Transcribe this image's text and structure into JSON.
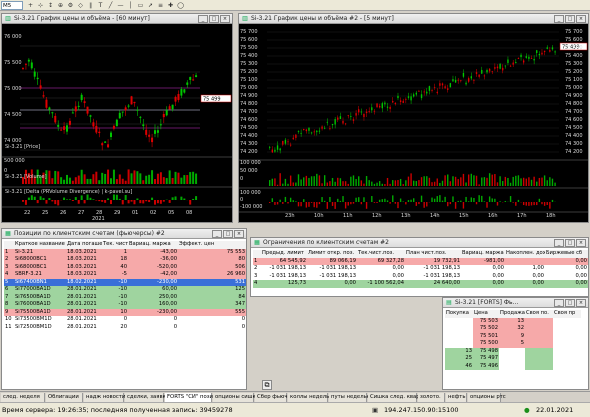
{
  "toolbar": {
    "selector_value": "M5",
    "buttons": [
      {
        "name": "add-button",
        "glyph": "+"
      },
      {
        "name": "crosshair-icon",
        "glyph": "⊹"
      },
      {
        "name": "move-icon",
        "glyph": "↕"
      },
      {
        "name": "zoom-in-icon",
        "glyph": "⊕"
      },
      {
        "name": "settings-icon",
        "glyph": "⚙"
      },
      {
        "name": "shape-icon",
        "glyph": "◇"
      },
      {
        "name": "channel-icon",
        "glyph": "∥"
      },
      {
        "name": "text-tool-icon",
        "glyph": "T"
      },
      {
        "name": "line-tool-icon",
        "glyph": "╱"
      },
      {
        "name": "hline-tool-icon",
        "glyph": "—"
      },
      {
        "name": "vline-tool-icon",
        "glyph": "│"
      },
      {
        "name": "rect-tool-icon",
        "glyph": "▭"
      },
      {
        "name": "arrow-tool-icon",
        "glyph": "➚"
      },
      {
        "name": "fib-tool-icon",
        "glyph": "≡"
      },
      {
        "name": "mark-tool-icon",
        "glyph": "✚"
      },
      {
        "name": "cycle-tool-icon",
        "glyph": "◯"
      }
    ]
  },
  "chart1": {
    "title": "Si-3.21 График цены и объёма - [60 минут]",
    "price_label": "Si-3.21 [Price]",
    "volume_label": "Si-3.21 [Volume]",
    "delta_label": "Si-3.21 [Delta (PRVolume Divergence) | k-pavel.su]",
    "price_ticks": [
      "76 000",
      "75 500",
      "75 000",
      "74 500",
      "74 000"
    ],
    "last_price": "75 499",
    "volume_ticks": [
      "500 000",
      "0"
    ],
    "x_ticks": [
      "22",
      "25",
      "26",
      "27",
      "28",
      "29",
      "01",
      "02",
      "05",
      "08",
      "10",
      "13",
      "14",
      "15",
      "16",
      "17",
      "18",
      "19",
      "20"
    ],
    "x_year": "2021"
  },
  "chart2": {
    "title": "Si-3.21 График цены и объёма #2 - [5 минут]",
    "price_ticks": [
      "75 700",
      "75 600",
      "75 500",
      "75 400",
      "75 300",
      "75 200",
      "75 100",
      "75 000",
      "74 900",
      "74 800",
      "74 700",
      "74 600",
      "74 500",
      "74 400",
      "74 300",
      "74 200"
    ],
    "last_price": "75 499",
    "volume_ticks": [
      "100 000",
      "50 000",
      "0"
    ],
    "delta_ticks": [
      "100 000",
      "0",
      "-100 000"
    ],
    "x_ticks": [
      "23h",
      "10h",
      "11h",
      "12h",
      "13h",
      "14h",
      "15h",
      "16h",
      "17h",
      "18h"
    ]
  },
  "positions": {
    "title": "Позиции по клиентским счетам (фьючерсы) #2",
    "headers": [
      "",
      "Краткое название",
      "Дата погаше",
      "Тек. чист",
      "Вариац. маржа",
      "Эффект. цен"
    ],
    "rows": [
      {
        "n": "1",
        "name": "Si-3.21",
        "date": "18.03.2021",
        "qty": "1",
        "var": "-43,00",
        "price": "75 553",
        "style": "red"
      },
      {
        "n": "2",
        "name": "Si68000BC1",
        "date": "18.03.2021",
        "qty": "18",
        "var": "-36,00",
        "price": "80",
        "style": "red"
      },
      {
        "n": "3",
        "name": "Si68000BC1",
        "date": "18.03.2021",
        "qty": "40",
        "var": "-520,00",
        "price": "506",
        "style": "red"
      },
      {
        "n": "4",
        "name": "SBRF-3.21",
        "date": "18.03.2021",
        "qty": "-5",
        "var": "-42,00",
        "price": "26 960",
        "style": "red"
      },
      {
        "n": "5",
        "name": "Si67400BN1",
        "date": "18.02.2021",
        "qty": "-10",
        "var": "-230,00",
        "price": "531",
        "style": "sel"
      },
      {
        "n": "6",
        "name": "Si77000BA1D",
        "date": "28.01.2021",
        "qty": "-10",
        "var": "60,00",
        "price": "125",
        "style": "green"
      },
      {
        "n": "7",
        "name": "Si76500BA1D",
        "date": "28.01.2021",
        "qty": "-10",
        "var": "250,00",
        "price": "84",
        "style": "green"
      },
      {
        "n": "8",
        "name": "Si76000BA1D",
        "date": "28.01.2021",
        "qty": "-10",
        "var": "160,00",
        "price": "347",
        "style": "green"
      },
      {
        "n": "9",
        "name": "Si75500BA1D",
        "date": "28.01.2021",
        "qty": "10",
        "var": "-230,00",
        "price": "555",
        "style": "red"
      },
      {
        "n": "10",
        "name": "Si73500BM1D",
        "date": "28.01.2021",
        "qty": "0",
        "var": "0",
        "price": "0",
        "style": "plain"
      },
      {
        "n": "11",
        "name": "Si72500BM1D",
        "date": "28.01.2021",
        "qty": "20",
        "var": "0",
        "price": "0",
        "style": "plain"
      }
    ]
  },
  "limits": {
    "title": "Ограничения по клиентским счетам #2",
    "headers": [
      "",
      "Предыд. лимит",
      "Лимит откр. поз.",
      "Тек.чист.поз.",
      "План чист.поз.",
      "Вариац. маржа",
      "Накоплен. доход",
      "Биржевые сб"
    ],
    "rows": [
      {
        "n": "1",
        "c1": "64 545,92",
        "c2": "89 066,19",
        "c3": "69 327,28",
        "c4": "19 732,91",
        "c5": "-981,00",
        "c6": "",
        "c7": "0,00",
        "style": "red"
      },
      {
        "n": "2",
        "c1": "-1 031 198,13",
        "c2": "-1 031 198,13",
        "c3": "0,00",
        "c4": "-1 031 198,13",
        "c5": "0,00",
        "c6": "1,00",
        "c7": "0,00",
        "style": "plain"
      },
      {
        "n": "3",
        "c1": "-1 031 198,13",
        "c2": "-1 031 198,13",
        "c3": "0,00",
        "c4": "-1 031 198,13",
        "c5": "0,00",
        "c6": "0,00",
        "c7": "0,00",
        "style": "plain"
      },
      {
        "n": "4",
        "c1": "125,73",
        "c2": "0,00",
        "c3": "-1 100 562,04",
        "c4": "24 640,00",
        "c5": "0,00",
        "c6": "0,00",
        "c7": "0,00",
        "style": "green"
      }
    ]
  },
  "orderbook": {
    "title": "Si-3.21 [FORTS] Фь...",
    "headers": [
      "Покупка",
      "Цена",
      "Продажа",
      "Своя по.",
      "Своя пр"
    ],
    "rows": [
      {
        "buy": "",
        "price": "75 503",
        "sell": "13",
        "side": "ask"
      },
      {
        "buy": "",
        "price": "75 502",
        "sell": "32",
        "side": "ask"
      },
      {
        "buy": "",
        "price": "75 501",
        "sell": "9",
        "side": "ask"
      },
      {
        "buy": "",
        "price": "75 500",
        "sell": "5",
        "side": "ask"
      },
      {
        "buy": "13",
        "price": "75 498",
        "sell": "",
        "side": "bid"
      },
      {
        "buy": "25",
        "price": "75 497",
        "sell": "",
        "side": "bid"
      },
      {
        "buy": "46",
        "price": "75 496",
        "sell": "",
        "side": "bid"
      }
    ]
  },
  "tabs": [
    "след. неделя",
    "Облигации",
    "надж новости",
    "сделки, заявки",
    "FORTS \"СИ\" позици.",
    "опционы сишка",
    "Сбер фьюч",
    "коллы недель.",
    "путы недельки",
    "Сишка след. квартал",
    "золото.",
    "нефть",
    "опционы ртс"
  ],
  "active_tab": "FORTS \"СИ\" позици.",
  "status": {
    "server_time": "Время сервера: 19:26:35; последняя полученная запись: 39459278",
    "ip": "194.247.150.90:15100",
    "date": "22.01.2021"
  },
  "colors": {
    "bull": "#00c800",
    "bear": "#e00000",
    "volume_up": "#00aa00",
    "volume_down": "#cc0000"
  }
}
